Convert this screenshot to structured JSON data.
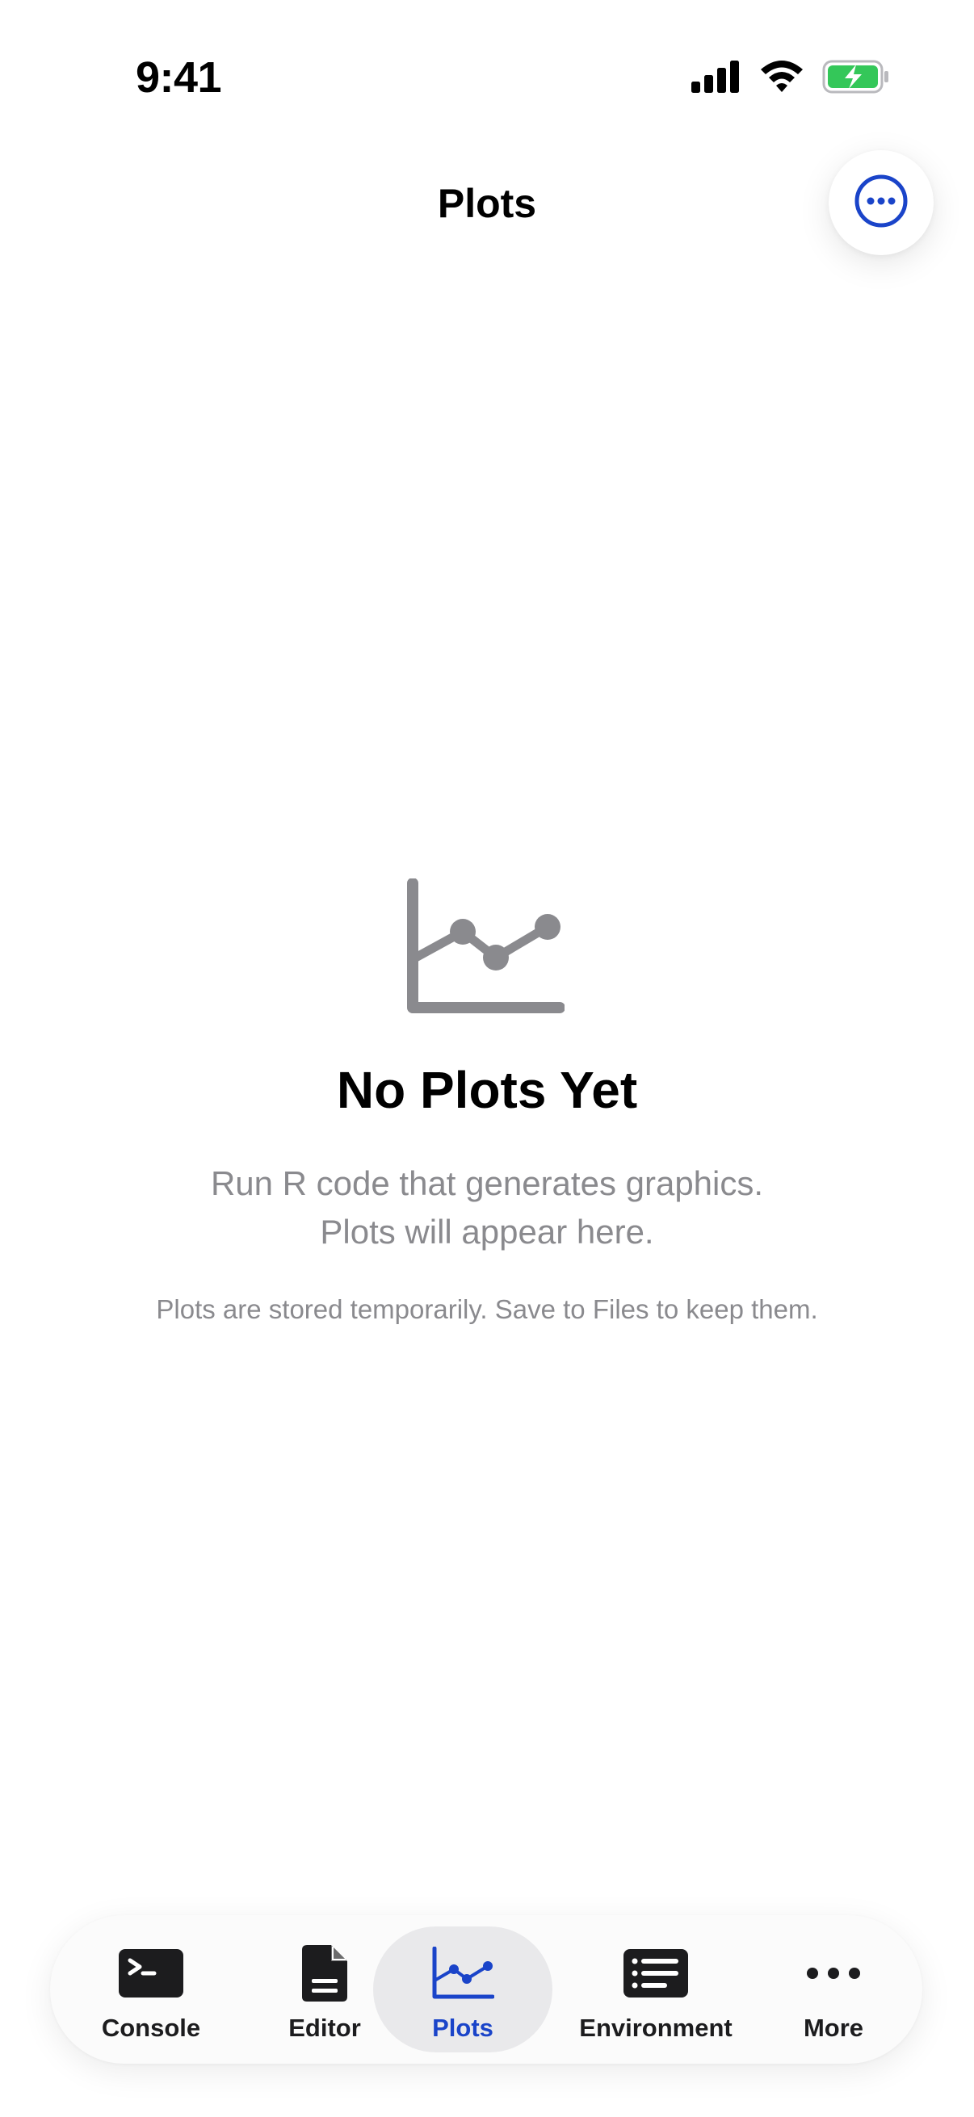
{
  "status_bar": {
    "time": "9:41",
    "icons": [
      "cellular-signal-icon",
      "wifi-icon",
      "battery-charging-icon"
    ]
  },
  "nav": {
    "title": "Plots",
    "more_icon": "ellipsis-circle-icon"
  },
  "empty_state": {
    "icon": "line-chart-icon",
    "title": "No Plots Yet",
    "subtitle_line1": "Run R code that generates graphics.",
    "subtitle_line2": "Plots will appear here.",
    "note": "Plots are stored temporarily. Save to Files to keep them."
  },
  "tab_bar": {
    "active": "Plots",
    "items": [
      {
        "label": "Console",
        "icon": "terminal-icon"
      },
      {
        "label": "Editor",
        "icon": "document-icon"
      },
      {
        "label": "Plots",
        "icon": "chart-icon"
      },
      {
        "label": "Environment",
        "icon": "list-icon"
      },
      {
        "label": "More",
        "icon": "ellipsis-icon"
      }
    ]
  },
  "colors": {
    "accent": "#1a44c9",
    "secondary_text": "#8a8a8e",
    "battery_green": "#34c759",
    "icon_gray": "#8a8a8e"
  }
}
